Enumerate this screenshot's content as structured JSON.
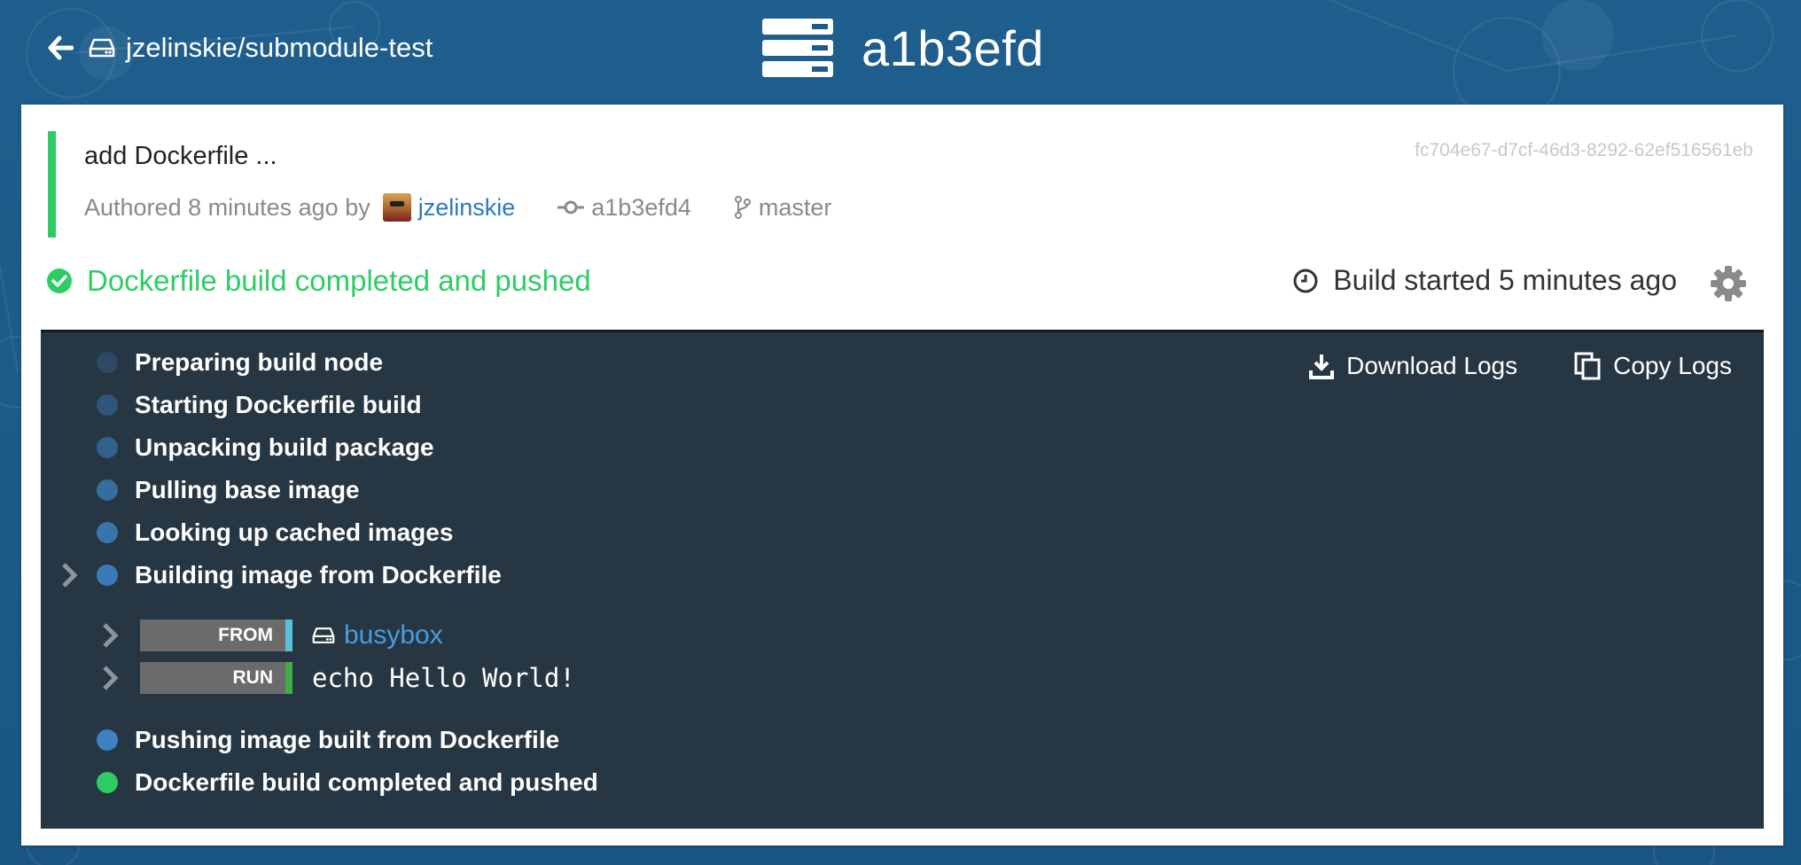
{
  "header": {
    "repo_name": "jzelinskie/submodule-test",
    "build_title": "a1b3efd"
  },
  "commit": {
    "message": "add Dockerfile ...",
    "authored_prefix": "Authored 8 minutes ago by",
    "author": "jzelinskie",
    "sha": "a1b3efd4",
    "branch": "master",
    "build_id": "fc704e67-d7cf-46d3-8292-62ef516561eb"
  },
  "status": {
    "text": "Dockerfile build completed and pushed",
    "started": "Build started 5 minutes ago",
    "color": "#2fcc66"
  },
  "logs": {
    "download_label": "Download Logs",
    "copy_label": "Copy Logs",
    "phases": [
      {
        "label": "Preparing build node",
        "color": "#2c4a63"
      },
      {
        "label": "Starting Dockerfile build",
        "color": "#2f5678"
      },
      {
        "label": "Unpacking build package",
        "color": "#31608a"
      },
      {
        "label": "Pulling base image",
        "color": "#346d9e"
      },
      {
        "label": "Looking up cached images",
        "color": "#3775ab"
      },
      {
        "label": "Building image from Dockerfile",
        "color": "#3a7bb6"
      },
      {
        "label": "Pushing image built from Dockerfile",
        "color": "#3d82c2"
      },
      {
        "label": "Dockerfile build completed and pushed",
        "color": "#2fcc66"
      }
    ],
    "commands": [
      {
        "tag": "FROM",
        "value": "busybox",
        "strip_color": "#5bc0de"
      },
      {
        "tag": "RUN",
        "value": "echo Hello World!",
        "strip_color": "#3fae49"
      }
    ]
  }
}
